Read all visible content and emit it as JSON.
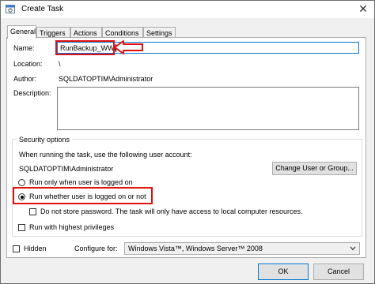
{
  "window": {
    "title": "Create Task"
  },
  "tabs": [
    "General",
    "Triggers",
    "Actions",
    "Conditions",
    "Settings"
  ],
  "general": {
    "name_label": "Name:",
    "name_value": "RunBackup_WWI",
    "location_label": "Location:",
    "location_value": "\\",
    "author_label": "Author:",
    "author_value": "SQLDATOPTIM\\Administrator",
    "description_label": "Description:",
    "description_value": ""
  },
  "security": {
    "title": "Security options",
    "account_prompt": "When running the task, use the following user account:",
    "account_value": "SQLDATOPTIM\\Administrator",
    "change_button": "Change User or Group...",
    "option_logged_on": "Run only when user is logged on",
    "option_whether": "Run whether user is logged on or not",
    "selected_option": "Run whether user is logged on or not",
    "do_not_store": "Do not store password.  The task will only have access to local computer resources.",
    "highest_privileges": "Run with highest privileges"
  },
  "footer": {
    "hidden_label": "Hidden",
    "configure_label": "Configure for:",
    "configure_value": "Windows Vista™, Windows Server™ 2008",
    "ok_button": "OK",
    "cancel_button": "Cancel"
  },
  "colors": {
    "highlight": "#e01010",
    "focus": "#0078d7"
  },
  "icons": [
    "task-scheduler-icon",
    "close-icon",
    "red-arrow-icon",
    "chevron-down-icon"
  ]
}
